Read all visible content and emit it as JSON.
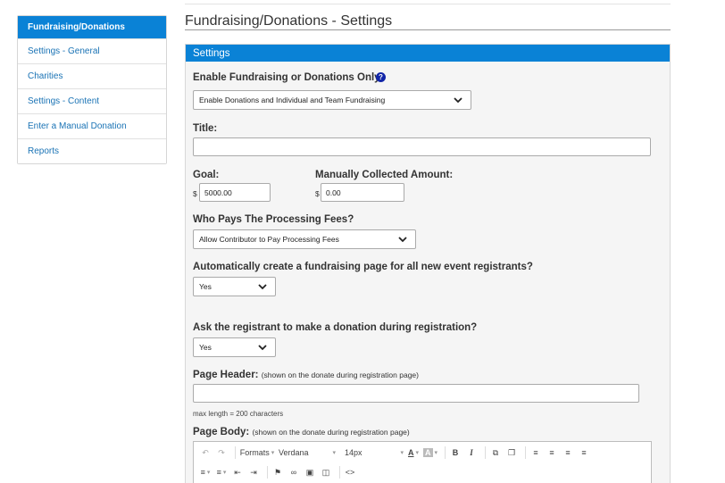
{
  "sidebar": {
    "items": [
      {
        "label": "Fundraising/Donations"
      },
      {
        "label": "Settings - General"
      },
      {
        "label": "Charities"
      },
      {
        "label": "Settings - Content"
      },
      {
        "label": "Enter a Manual Donation"
      },
      {
        "label": "Reports"
      }
    ]
  },
  "page": {
    "title": "Fundraising/Donations - Settings"
  },
  "panel": {
    "header": "Settings",
    "enable": {
      "label": "Enable Fundraising or Donations Only:",
      "help_icon": "question-circle-icon",
      "value": "Enable Donations and Individual and Team Fundraising"
    },
    "title_field": {
      "label": "Title:",
      "value": ""
    },
    "goal": {
      "label": "Goal:",
      "currency": "$",
      "value": "5000.00"
    },
    "manual": {
      "label": "Manually Collected Amount:",
      "currency": "$",
      "value": "0.00"
    },
    "fees": {
      "label": "Who Pays The Processing Fees?",
      "value": "Allow Contributor to Pay Processing Fees"
    },
    "auto_page": {
      "label": "Automatically create a fundraising page for all new event registrants?",
      "value": "Yes"
    },
    "ask_donation": {
      "label": "Ask the registrant to make a donation during registration?",
      "value": "Yes"
    },
    "page_header": {
      "label": "Page Header:",
      "hint": "(shown on the donate during registration page)",
      "value": "",
      "note": "max length = 200 characters"
    },
    "page_body": {
      "label": "Page Body:",
      "hint": "(shown on the donate during registration page)"
    },
    "editor": {
      "formats": "Formats",
      "font": "Verdana",
      "size": "14px",
      "bold": "B",
      "italic": "I",
      "text_color": "A",
      "bg_color": "A"
    }
  },
  "colors": {
    "accent": "#0a82d6",
    "link": "#1a73b5",
    "help": "#1226a8"
  }
}
